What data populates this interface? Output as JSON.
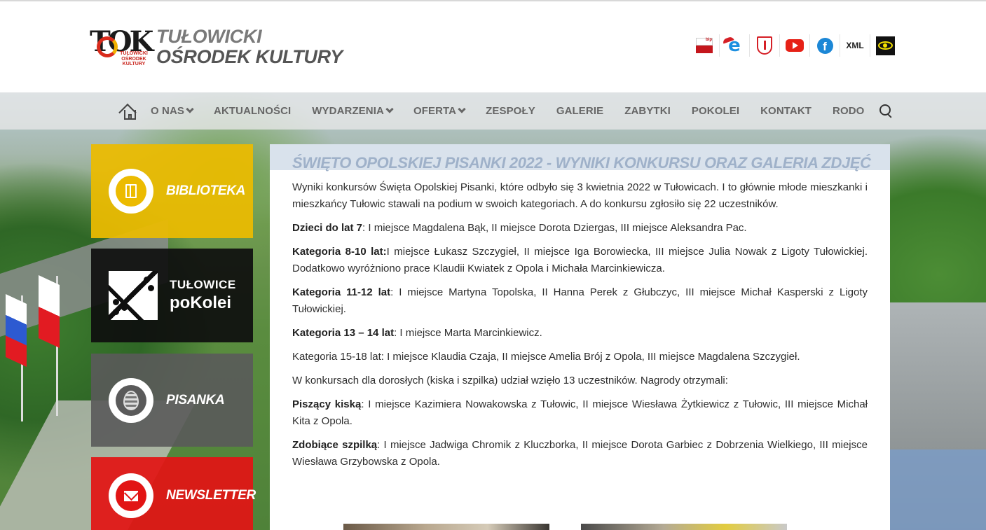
{
  "header": {
    "logo_text": "TOK",
    "logo_subtitle": "TUŁOWICKI OŚRODEK KULTURY",
    "title_line1": "TUŁOWICKI",
    "title_line2": "OŚRODEK KULTURY",
    "icons": [
      {
        "name": "bip-icon",
        "label": "bip"
      },
      {
        "name": "epuap-icon",
        "label": "e"
      },
      {
        "name": "coat-of-arms-icon"
      },
      {
        "name": "youtube-icon"
      },
      {
        "name": "facebook-icon",
        "label": "f"
      },
      {
        "name": "xml-icon",
        "label": "XML"
      },
      {
        "name": "accessibility-eye-icon"
      }
    ]
  },
  "nav": {
    "items": [
      {
        "label": "O NAS",
        "dropdown": true
      },
      {
        "label": "AKTUALNOŚCI",
        "dropdown": false
      },
      {
        "label": "WYDARZENIA",
        "dropdown": true
      },
      {
        "label": "OFERTA",
        "dropdown": true
      },
      {
        "label": "ZESPOŁY",
        "dropdown": false
      },
      {
        "label": "GALERIE",
        "dropdown": false
      },
      {
        "label": "ZABYTKI",
        "dropdown": false
      },
      {
        "label": "POKOLEI",
        "dropdown": false
      },
      {
        "label": "KONTAKT",
        "dropdown": false
      },
      {
        "label": "RODO",
        "dropdown": false
      }
    ]
  },
  "sidebar": {
    "biblioteka": "BIBLIOTEKA",
    "pokolei_line1": "TUŁOWICE",
    "pokolei_line2": "poKolei",
    "pisanka": "PISANKA",
    "newsletter": "NEWSLETTER"
  },
  "article": {
    "title": "ŚWIĘTO OPOLSKIEJ PISANKI 2022 - WYNIKI KONKURSU ORAZ GALERIA ZDJĘĆ",
    "intro": "Wyniki konkursów Święta Opolskiej Pisanki, które odbyło się 3 kwietnia 2022 w Tułowicach. I to głównie młode mieszkanki i mieszkańcy Tułowic stawali na podium w swoich kategoriach. A do konkursu zgłosiło się 22 uczestników.",
    "p1_label": "Dzieci do lat 7",
    "p1_text": ": I miejsce Magdalena Bąk, II miejsce Dorota Dziergas, III miejsce Aleksandra Pac.",
    "p2_label": "Kategoria 8-10 lat:",
    "p2_text": "I miejsce Łukasz Szczygieł, II miejsce Iga Borowiecka, III miejsce Julia Nowak z Ligoty Tułowickiej. Dodatkowo wyróżniono prace Klaudii Kwiatek z Opola i Michała Marcinkiewicza.",
    "p3_label": "Kategoria 11-12 lat",
    "p3_text": ": I miejsce Martyna Topolska, II Hanna Perek z Głubczyc, III miejsce Michał Kasperski z Ligoty Tułowickiej.",
    "p4_label": "Kategoria 13 – 14 lat",
    "p4_text": ": I miejsce Marta Marcinkiewicz.",
    "p5": "Kategoria 15-18 lat: I miejsce Klaudia Czaja, II miejsce Amelia Brój z Opola, III miejsce Magdalena Szczygieł.",
    "p6": "W konkursach dla dorosłych (kiska i szpilka) udział wzięło 13 uczestników. Nagrody otrzymali:",
    "p7_label": "Piszący kiską",
    "p7_text": ": I miejsce Kazimiera Nowakowska z Tułowic, II miejsce Wiesława Żytkiewicz z Tułowic, III miejsce Michał Kita z Opola.",
    "p8_label": "Zdobiące szpilką",
    "p8_text": ": I miejsce Jadwiga Chromik z Kluczborka, II miejsce Dorota Garbiec z Dobrzenia Wielkiego, III miejsce Wiesława Grzybowska z Opola."
  },
  "colors": {
    "biblioteka": "#ecbb00",
    "pokolei": "#0e0e0e",
    "pisanka": "#5a5a5a",
    "newsletter": "#e21414",
    "article_title": "#9fb1c9"
  }
}
